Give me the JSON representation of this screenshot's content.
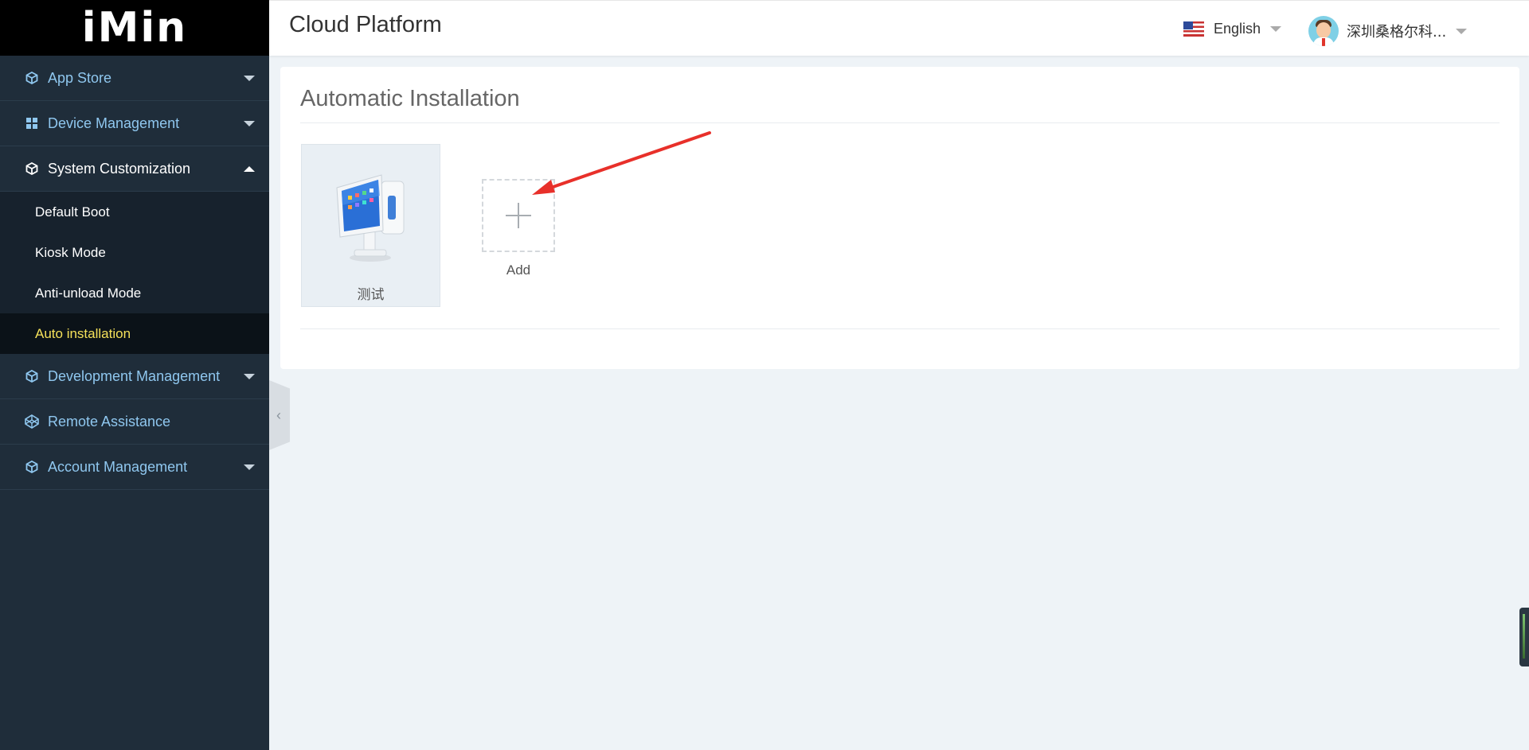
{
  "brand": {
    "logo_text": "iMin"
  },
  "header": {
    "title": "Cloud Platform",
    "language": "English",
    "user_name": "深圳桑格尔科..."
  },
  "sidebar": {
    "items": [
      {
        "label": "App Store",
        "icon": "cube-icon"
      },
      {
        "label": "Device Management",
        "icon": "grid-icon"
      },
      {
        "label": "System Customization",
        "icon": "cube-icon",
        "expanded": true,
        "children": [
          {
            "label": "Default Boot"
          },
          {
            "label": "Kiosk Mode"
          },
          {
            "label": "Anti-unload Mode"
          },
          {
            "label": "Auto installation",
            "active": true
          }
        ]
      },
      {
        "label": "Development Management",
        "icon": "cube-icon"
      },
      {
        "label": "Remote Assistance",
        "icon": "codepen-icon"
      },
      {
        "label": "Account Management",
        "icon": "cube-icon"
      }
    ]
  },
  "main": {
    "title": "Automatic Installation",
    "devices": [
      {
        "name": "测试"
      }
    ],
    "add_label": "Add"
  },
  "colors": {
    "sidebar_bg": "#1f2d3a",
    "active_sub_text": "#f5e15a",
    "nav_text": "#8fc7ef",
    "annotation_arrow": "#e8302a"
  }
}
